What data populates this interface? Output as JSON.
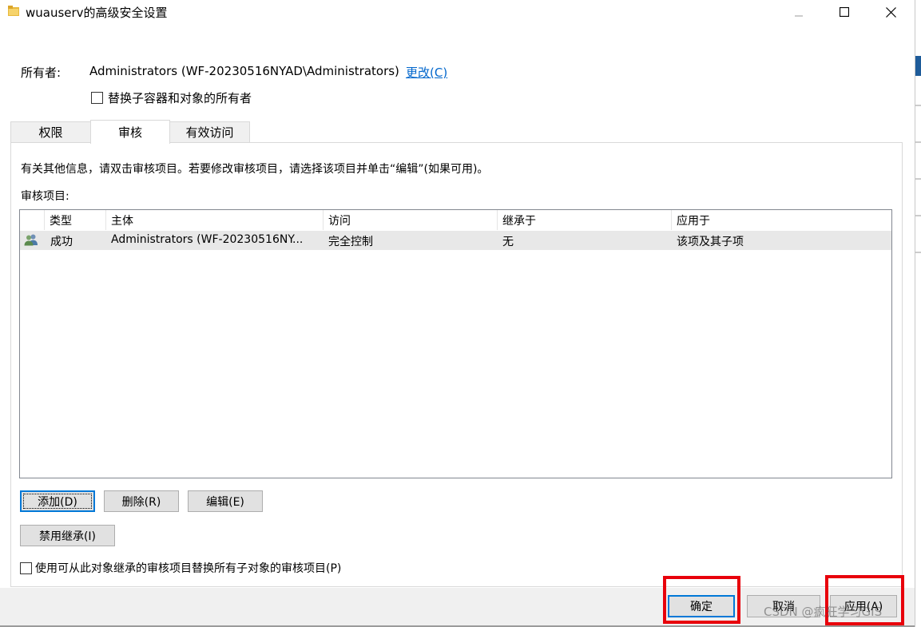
{
  "window": {
    "title": "wuauserv的高级安全设置"
  },
  "owner": {
    "label": "所有者:",
    "value": "Administrators (WF-20230516NYAD\\Administrators)",
    "change_link": "更改(C)",
    "replace_checkbox_label": "替换子容器和对象的所有者"
  },
  "tabs": [
    {
      "label": "权限"
    },
    {
      "label": "审核"
    },
    {
      "label": "有效访问"
    }
  ],
  "auditing": {
    "info_text": "有关其他信息，请双击审核项目。若要修改审核项目，请选择该项目并单击“编辑”(如果可用)。",
    "entries_label": "审核项目:",
    "columns": [
      "类型",
      "主体",
      "访问",
      "继承于",
      "应用于"
    ],
    "rows": [
      {
        "icon": "users-icon",
        "type": "成功",
        "principal": "Administrators (WF-20230516NY...",
        "access": "完全控制",
        "inherited_from": "无",
        "applies_to": "该项及其子项"
      }
    ],
    "buttons": {
      "add": "添加(D)",
      "remove": "删除(R)",
      "edit": "编辑(E)",
      "disable_inheritance": "禁用继承(I)"
    },
    "replace_child_label": "使用可从此对象继承的审核项目替换所有子对象的审核项目(P)"
  },
  "footer": {
    "ok": "确定",
    "cancel": "取消",
    "apply": "应用(A)"
  },
  "watermark": "CSDN @疯狂学习GIS",
  "colors": {
    "accent": "#0078d7",
    "link": "#0066cc",
    "highlight_box": "#e8000b",
    "button_face": "#e1e1e1",
    "footer_bg": "#f0f0f0"
  }
}
